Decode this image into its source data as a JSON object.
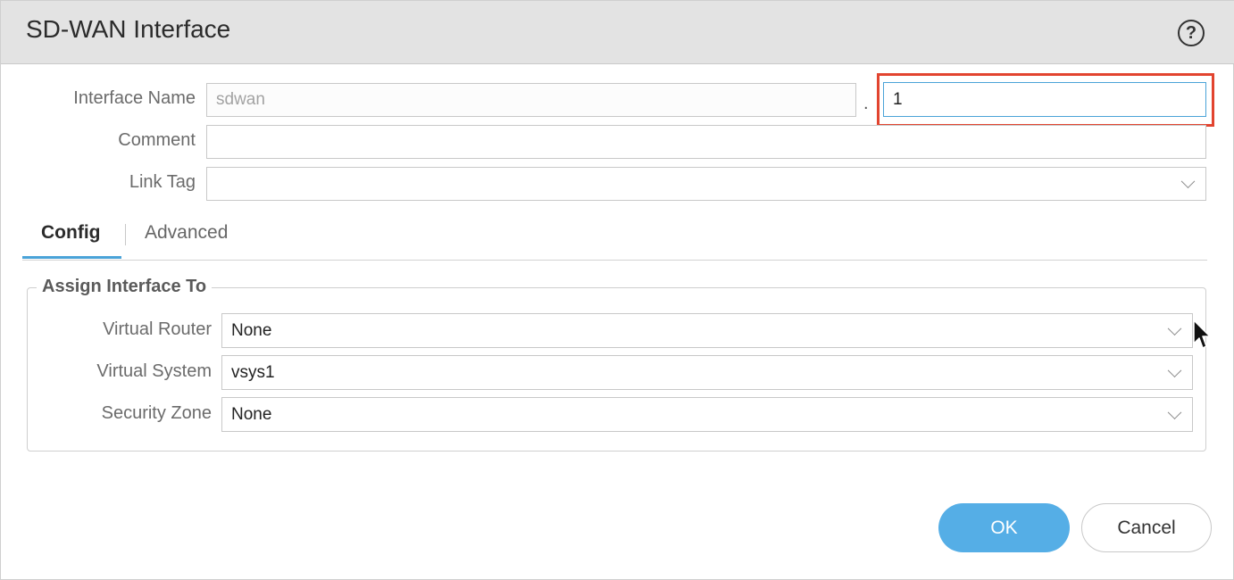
{
  "dialog": {
    "title": "SD-WAN Interface",
    "help_icon": "question-circle-icon"
  },
  "form": {
    "interface_name_label": "Interface Name",
    "interface_name_prefix": "sdwan",
    "separator": ".",
    "interface_name_suffix": "1",
    "comment_label": "Comment",
    "comment_value": "",
    "link_tag_label": "Link Tag",
    "link_tag_value": ""
  },
  "tabs": [
    {
      "label": "Config",
      "active": true
    },
    {
      "label": "Advanced",
      "active": false
    }
  ],
  "assign": {
    "title": "Assign Interface To",
    "virtual_router_label": "Virtual Router",
    "virtual_router_value": "None",
    "virtual_system_label": "Virtual System",
    "virtual_system_value": "vsys1",
    "security_zone_label": "Security Zone",
    "security_zone_value": "None"
  },
  "buttons": {
    "ok": "OK",
    "cancel": "Cancel"
  },
  "colors": {
    "accent": "#4aa3d8",
    "ok_button": "#55aee6",
    "highlight_box": "#e2442f",
    "titlebar": "#e3e3e3"
  }
}
